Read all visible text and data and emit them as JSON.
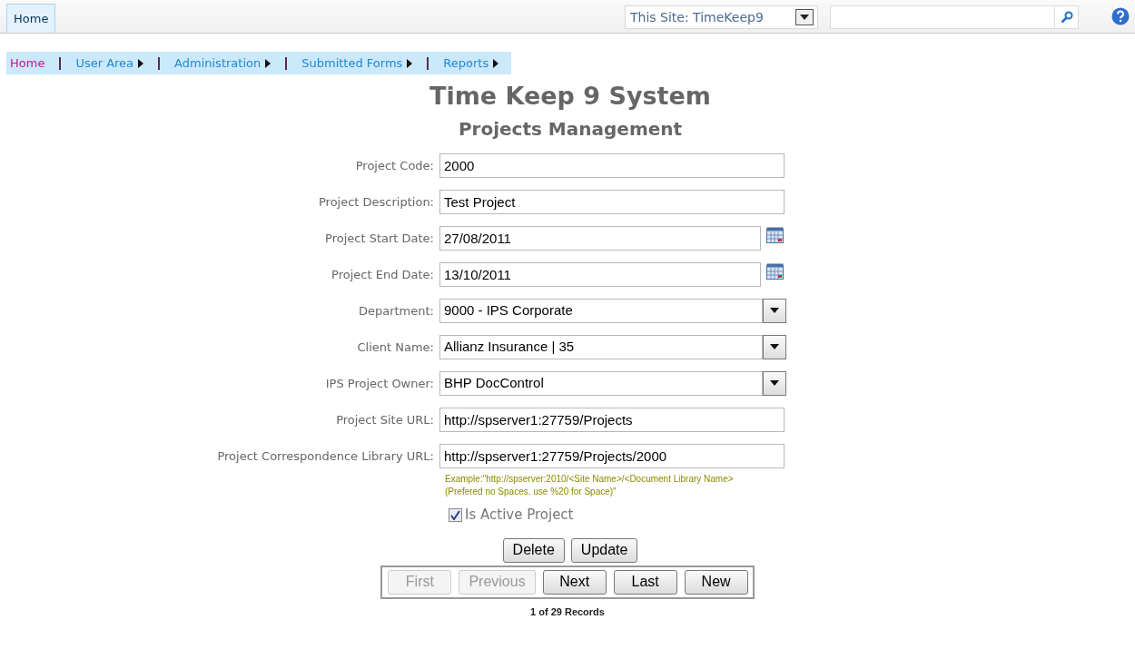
{
  "top_bar": {
    "tab": {
      "label": "Home",
      "selected": true
    },
    "scope": "This Site: TimeKeep9"
  },
  "nav": [
    {
      "label": "Home",
      "selected": true,
      "submenu": false
    },
    {
      "label": "User Area",
      "selected": false,
      "submenu": true
    },
    {
      "label": "Administration",
      "selected": false,
      "submenu": true
    },
    {
      "label": "Submitted Forms",
      "selected": false,
      "submenu": true
    },
    {
      "label": "Reports",
      "selected": false,
      "submenu": true
    }
  ],
  "title": "Time Keep 9 System",
  "subtitle": "Projects Management",
  "fields": [
    {
      "label": "Project Code:",
      "kind": "text",
      "value": "2000"
    },
    {
      "label": "Project Description:",
      "kind": "text",
      "value": "Test Project"
    },
    {
      "label": "Project Start Date:",
      "kind": "date",
      "value": "27/08/2011"
    },
    {
      "label": "Project End Date:",
      "kind": "date",
      "value": "13/10/2011"
    },
    {
      "label": "Department:",
      "kind": "select",
      "value": "9000 - IPS Corporate"
    },
    {
      "label": "Client Name:",
      "kind": "select",
      "value": "Allianz Insurance | 35"
    },
    {
      "label": "IPS Project Owner:",
      "kind": "select",
      "value": "BHP DocControl"
    },
    {
      "label": "Project Site URL:",
      "kind": "text",
      "value": "http://spserver1:27759/Projects"
    },
    {
      "label": "Project Correspondence Library URL:",
      "kind": "text",
      "value": "http://spserver1:27759/Projects/2000"
    }
  ],
  "hint": [
    "Example:\"http://spserver:2010/<Site Name>/<Document Library Name>",
    "(Prefered no Spaces. use %20 for Space)\""
  ],
  "active": {
    "label": "Is Active Project",
    "checked": true
  },
  "actions": [
    "Delete",
    "Update"
  ],
  "pager": [
    {
      "label": "First",
      "disabled": true
    },
    {
      "label": "Previous",
      "disabled": true
    },
    {
      "label": "Next",
      "disabled": false
    },
    {
      "label": "Last",
      "disabled": false
    },
    {
      "label": "New",
      "disabled": false
    }
  ],
  "record_count": "1 of 29 Records"
}
